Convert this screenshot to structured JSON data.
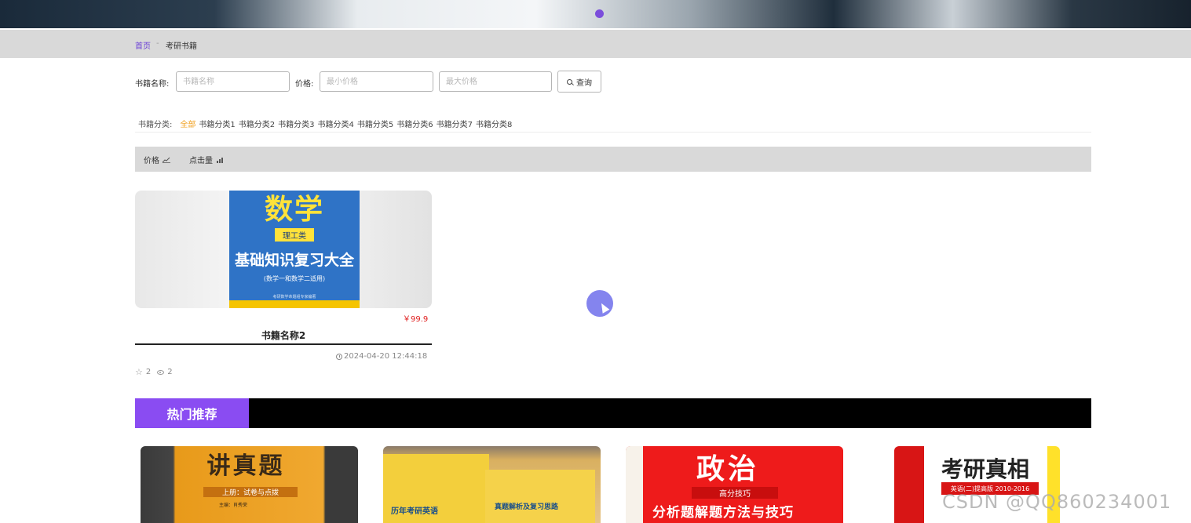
{
  "breadcrumb": {
    "home": "首页",
    "separator": "-",
    "current": "考研书籍"
  },
  "search": {
    "name_label": "书籍名称:",
    "name_placeholder": "书籍名称",
    "price_label": "价格:",
    "min_placeholder": "最小价格",
    "max_placeholder": "最大价格",
    "button_label": "查询"
  },
  "categories": {
    "label": "书籍分类:",
    "items": [
      "全部",
      "书籍分类1",
      "书籍分类2",
      "书籍分类3",
      "书籍分类4",
      "书籍分类5",
      "书籍分类6",
      "书籍分类7",
      "书籍分类8"
    ],
    "active": "全部"
  },
  "sort": {
    "price_label": "价格",
    "clicks_label": "点击量"
  },
  "book_card": {
    "cover": {
      "title": "数学",
      "subtitle": "理工类",
      "main": "基础知识复习大全",
      "note": "(数学一和数学二适用)",
      "publisher": "考研数学命题组专家编著"
    },
    "price": "￥99.9",
    "name": "书籍名称2",
    "time": "2024-04-20 12:44:18",
    "favorites": "2",
    "views": "2"
  },
  "hot": {
    "title": "热门推荐",
    "items": [
      {
        "title": "讲真题",
        "subtitle": "上册：试卷与点拨",
        "author": "主编：肖秀荣"
      },
      {
        "line1": "历年考研英语",
        "line2": "真题解析及复习思路"
      },
      {
        "title": "政治",
        "subtitle": "高分技巧",
        "main": "分析题解题方法与技巧"
      },
      {
        "title": "考研真相",
        "subtitle": "英语(二)提高版 2010-2016"
      }
    ]
  },
  "watermark": "CSDN @QQ860234001",
  "colors": {
    "accent": "#8a4cf2",
    "price": "#e02020",
    "active_category": "#f0a020",
    "link": "#6a3fd6"
  }
}
